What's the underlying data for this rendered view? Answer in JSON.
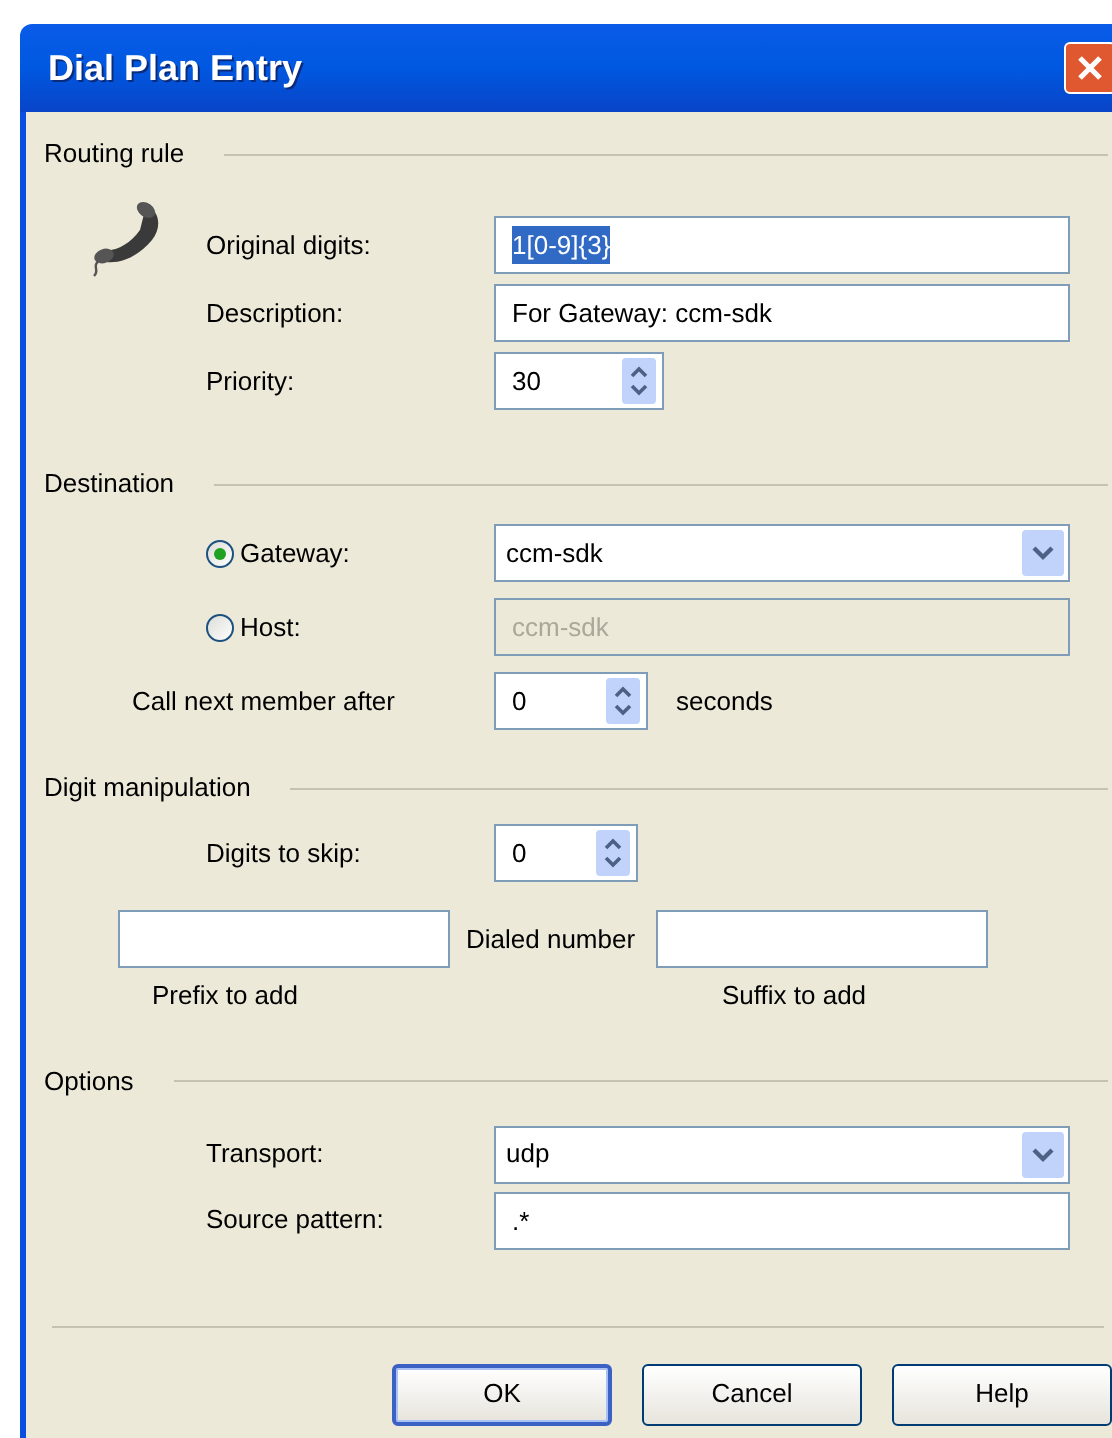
{
  "window": {
    "title": "Dial Plan Entry"
  },
  "routing_rule": {
    "heading": "Routing rule",
    "original_digits": {
      "label": "Original digits:",
      "value": "1[0-9]{3}",
      "selected": true
    },
    "description": {
      "label": "Description:",
      "value": "For Gateway: ccm-sdk"
    },
    "priority": {
      "label": "Priority:",
      "value": "30"
    }
  },
  "destination": {
    "heading": "Destination",
    "options": [
      {
        "label": "Gateway:",
        "selected": true,
        "kind": "dropdown",
        "value": "ccm-sdk",
        "disabled": false
      },
      {
        "label": "Host:",
        "selected": false,
        "kind": "text",
        "value": "ccm-sdk",
        "disabled": true
      }
    ],
    "call_next": {
      "label": "Call next member after",
      "value": "0",
      "unit": "seconds"
    }
  },
  "digit_manipulation": {
    "heading": "Digit manipulation",
    "digits_to_skip": {
      "label": "Digits to skip:",
      "value": "0"
    },
    "prefix": {
      "label": "Prefix to add"
    },
    "dialed_number": "Dialed number",
    "suffix": {
      "label": "Suffix to add"
    }
  },
  "options": {
    "heading": "Options",
    "transport": {
      "label": "Transport:",
      "value": "udp"
    },
    "source_pattern": {
      "label": "Source pattern:",
      "value": ".*"
    }
  },
  "buttons": [
    {
      "label": "OK",
      "default": true
    },
    {
      "label": "Cancel",
      "default": false
    },
    {
      "label": "Help",
      "default": false
    }
  ]
}
